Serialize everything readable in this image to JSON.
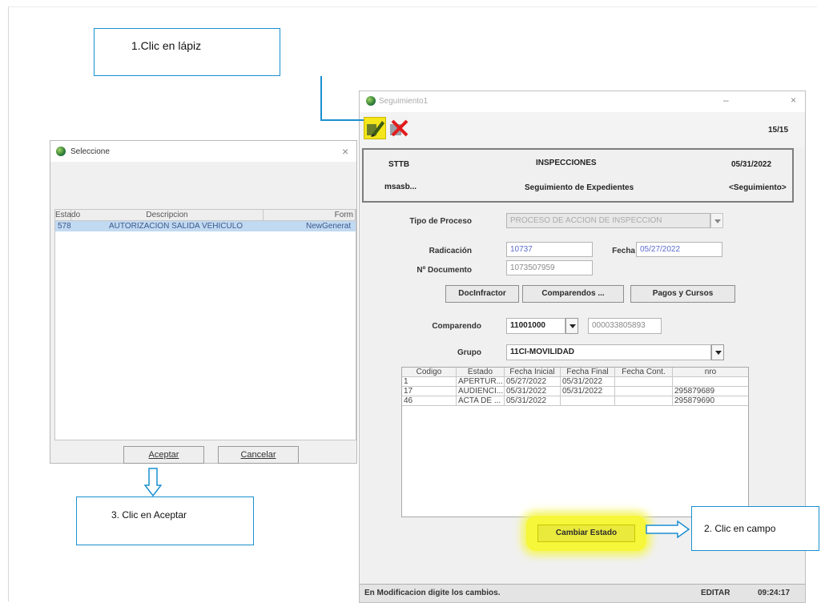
{
  "callouts": {
    "step1": "1.Clic en lápiz",
    "step2": "2. Clic en campo",
    "step3": "3. Clic en Aceptar"
  },
  "selection_dialog": {
    "title": "Seleccione",
    "close": "×",
    "columns": [
      "Estado",
      "Descripcion",
      "Form"
    ],
    "selected_row": [
      "578",
      "AUTORIZACION SALIDA VEHICULO",
      "NewGenerat"
    ],
    "accept_button": "Aceptar",
    "cancel_button": "Cancelar"
  },
  "seguimiento": {
    "title": "Seguimiento1",
    "minimize": "–",
    "close": "×",
    "record_counter": "15/15",
    "header": {
      "org": "STTB",
      "module": "INSPECCIONES",
      "date": "05/31/2022",
      "user": "msasb...",
      "subtitle": "Seguimiento de Expedientes",
      "tag": "<Seguimiento>"
    },
    "form": {
      "tipo_proceso_label": "Tipo de Proceso",
      "tipo_proceso_value": "PROCESO DE ACCION DE INSPECCION",
      "radicacion_label": "Radicación",
      "radicacion_value": "10737",
      "fecha_label": "Fecha",
      "fecha_value": "05/27/2022",
      "documento_label": "Nº Documento",
      "documento_value": "1073507959",
      "btn_doc_infractor": "DocInfractor",
      "btn_comparendos": "Comparendos ...",
      "btn_pagos": "Pagos y Cursos",
      "comparendo_label": "Comparendo",
      "comparendo_code": "11001000",
      "comparendo_number": "000033805893",
      "grupo_label": "Grupo",
      "grupo_value": "11CI-MOVILIDAD"
    },
    "grid": {
      "columns": [
        "Codigo",
        "Estado",
        "Fecha Inicial",
        "Fecha Final",
        "Fecha Cont.",
        "nro"
      ],
      "rows": [
        [
          "1",
          "APERTUR...",
          "05/27/2022",
          "05/31/2022",
          "",
          ""
        ],
        [
          "17",
          "AUDIENCI...",
          "05/31/2022",
          "05/31/2022",
          "",
          "295879689"
        ],
        [
          "46",
          "ACTA DE ...",
          "05/31/2022",
          "",
          "",
          "295879690"
        ]
      ]
    },
    "change_state_button": "Cambiar Estado",
    "status_bar": {
      "message": "En Modificacion digite los cambios.",
      "mode": "EDITAR",
      "time": "09:24:17"
    }
  },
  "colors": {
    "callout_border": "#1a8fd0",
    "highlight": "#f6f63a",
    "selected_row": "#c2d9f2"
  }
}
